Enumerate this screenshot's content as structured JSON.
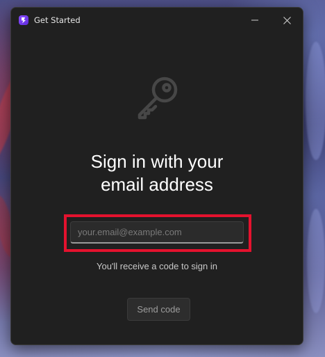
{
  "window": {
    "title": "Get Started",
    "logo_icon": "app-logo-icon",
    "minimize_icon": "minimize-icon",
    "close_icon": "close-icon"
  },
  "main": {
    "hero_icon": "key-icon",
    "heading_line1": "Sign in with your",
    "heading_line2": "email address",
    "email_placeholder": "your.email@example.com",
    "email_value": "",
    "hint": "You'll receive a code to sign in",
    "send_button_label": "Send code"
  },
  "colors": {
    "accent_logo": "#7b3cff",
    "highlight_border": "#e4122e",
    "window_bg": "#202020"
  }
}
